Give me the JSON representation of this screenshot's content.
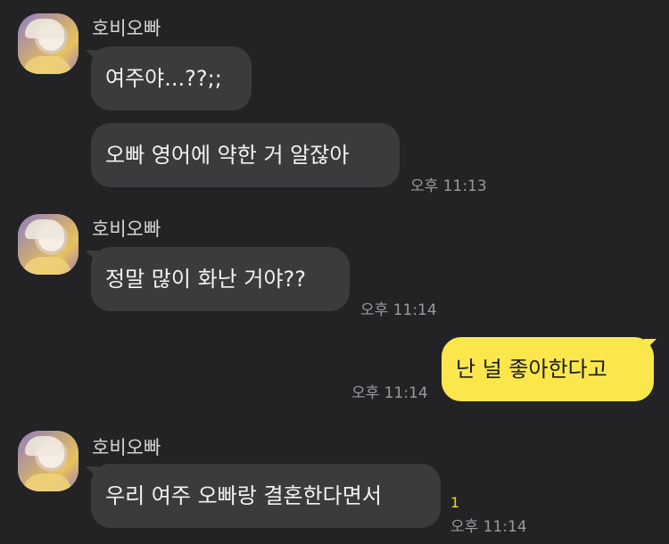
{
  "chat": {
    "groups": [
      {
        "sender": "호비오빠",
        "messages": [
          "여주야...??;;",
          "오빠 영어에 약한 거 알잖아"
        ],
        "time": "오후 11:13"
      },
      {
        "sender": "호비오빠",
        "messages": [
          "정말 많이 화난 거야??"
        ],
        "time": "오후 11:14"
      },
      {
        "mine": true,
        "messages": [
          "난 널 좋아한다고"
        ],
        "time": "오후 11:14"
      },
      {
        "sender": "호비오빠",
        "messages": [
          "우리 여주 오빠랑 결혼한다면서"
        ],
        "time": "오후 11:14",
        "unread": "1"
      }
    ]
  },
  "colors": {
    "background": "#232325",
    "incoming_bubble": "#3b3b3e",
    "outgoing_bubble": "#fbe74c",
    "unread_count": "#f2d52b"
  },
  "icons": {
    "avatar": "profile-photo"
  }
}
